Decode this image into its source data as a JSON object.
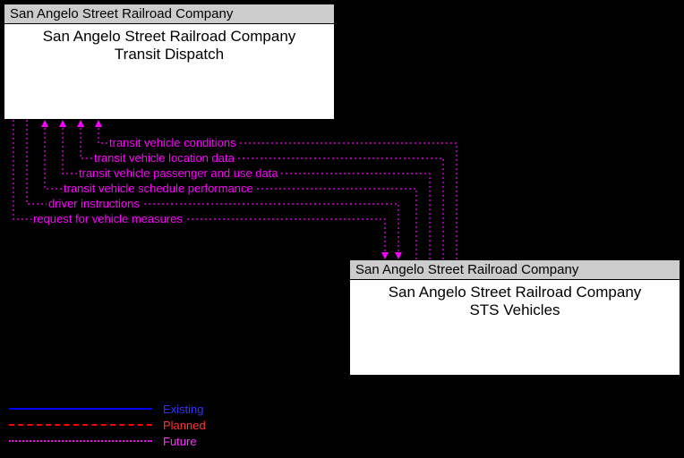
{
  "nodes": {
    "top": {
      "header": "San Angelo Street Railroad Company",
      "title_line1": "San Angelo Street Railroad Company",
      "title_line2": "Transit Dispatch"
    },
    "bottom": {
      "header": "San Angelo Street Railroad Company",
      "title_line1": "San Angelo Street Railroad Company",
      "title_line2": "STS Vehicles"
    }
  },
  "flows": {
    "f1": "transit vehicle conditions",
    "f2": "transit vehicle location data",
    "f3": "transit vehicle passenger and use data",
    "f4": "transit vehicle schedule performance",
    "f5": "driver instructions",
    "f6": "request for vehicle measures"
  },
  "legend": {
    "existing": "Existing",
    "planned": "Planned",
    "future": "Future"
  }
}
